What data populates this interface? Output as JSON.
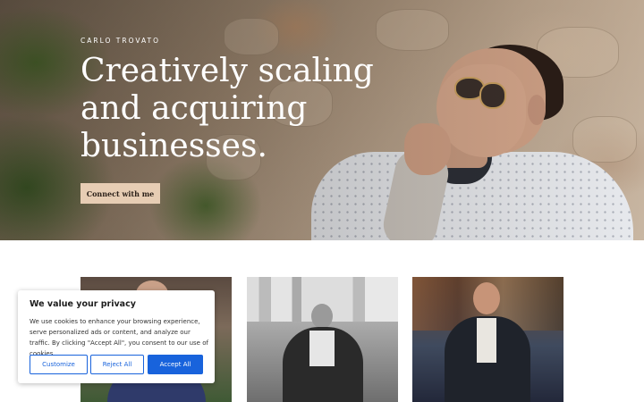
{
  "hero": {
    "eyebrow": "CARLO TROVATO",
    "headline_line1": "Creatively scaling",
    "headline_line2": "and acquiring",
    "headline_line3": "businesses.",
    "cta_label": "Connect with me"
  },
  "cookie_banner": {
    "title": "We value your privacy",
    "text": "We use cookies to enhance your browsing experience, serve personalized ads or content, and analyze our traffic. By clicking \"Accept All\", you consent to our use of cookies.",
    "customize_label": "Customize",
    "reject_label": "Reject All",
    "accept_label": "Accept All"
  },
  "colors": {
    "cta_background": "#e7cdb4",
    "cookie_accent": "#1863dc"
  }
}
